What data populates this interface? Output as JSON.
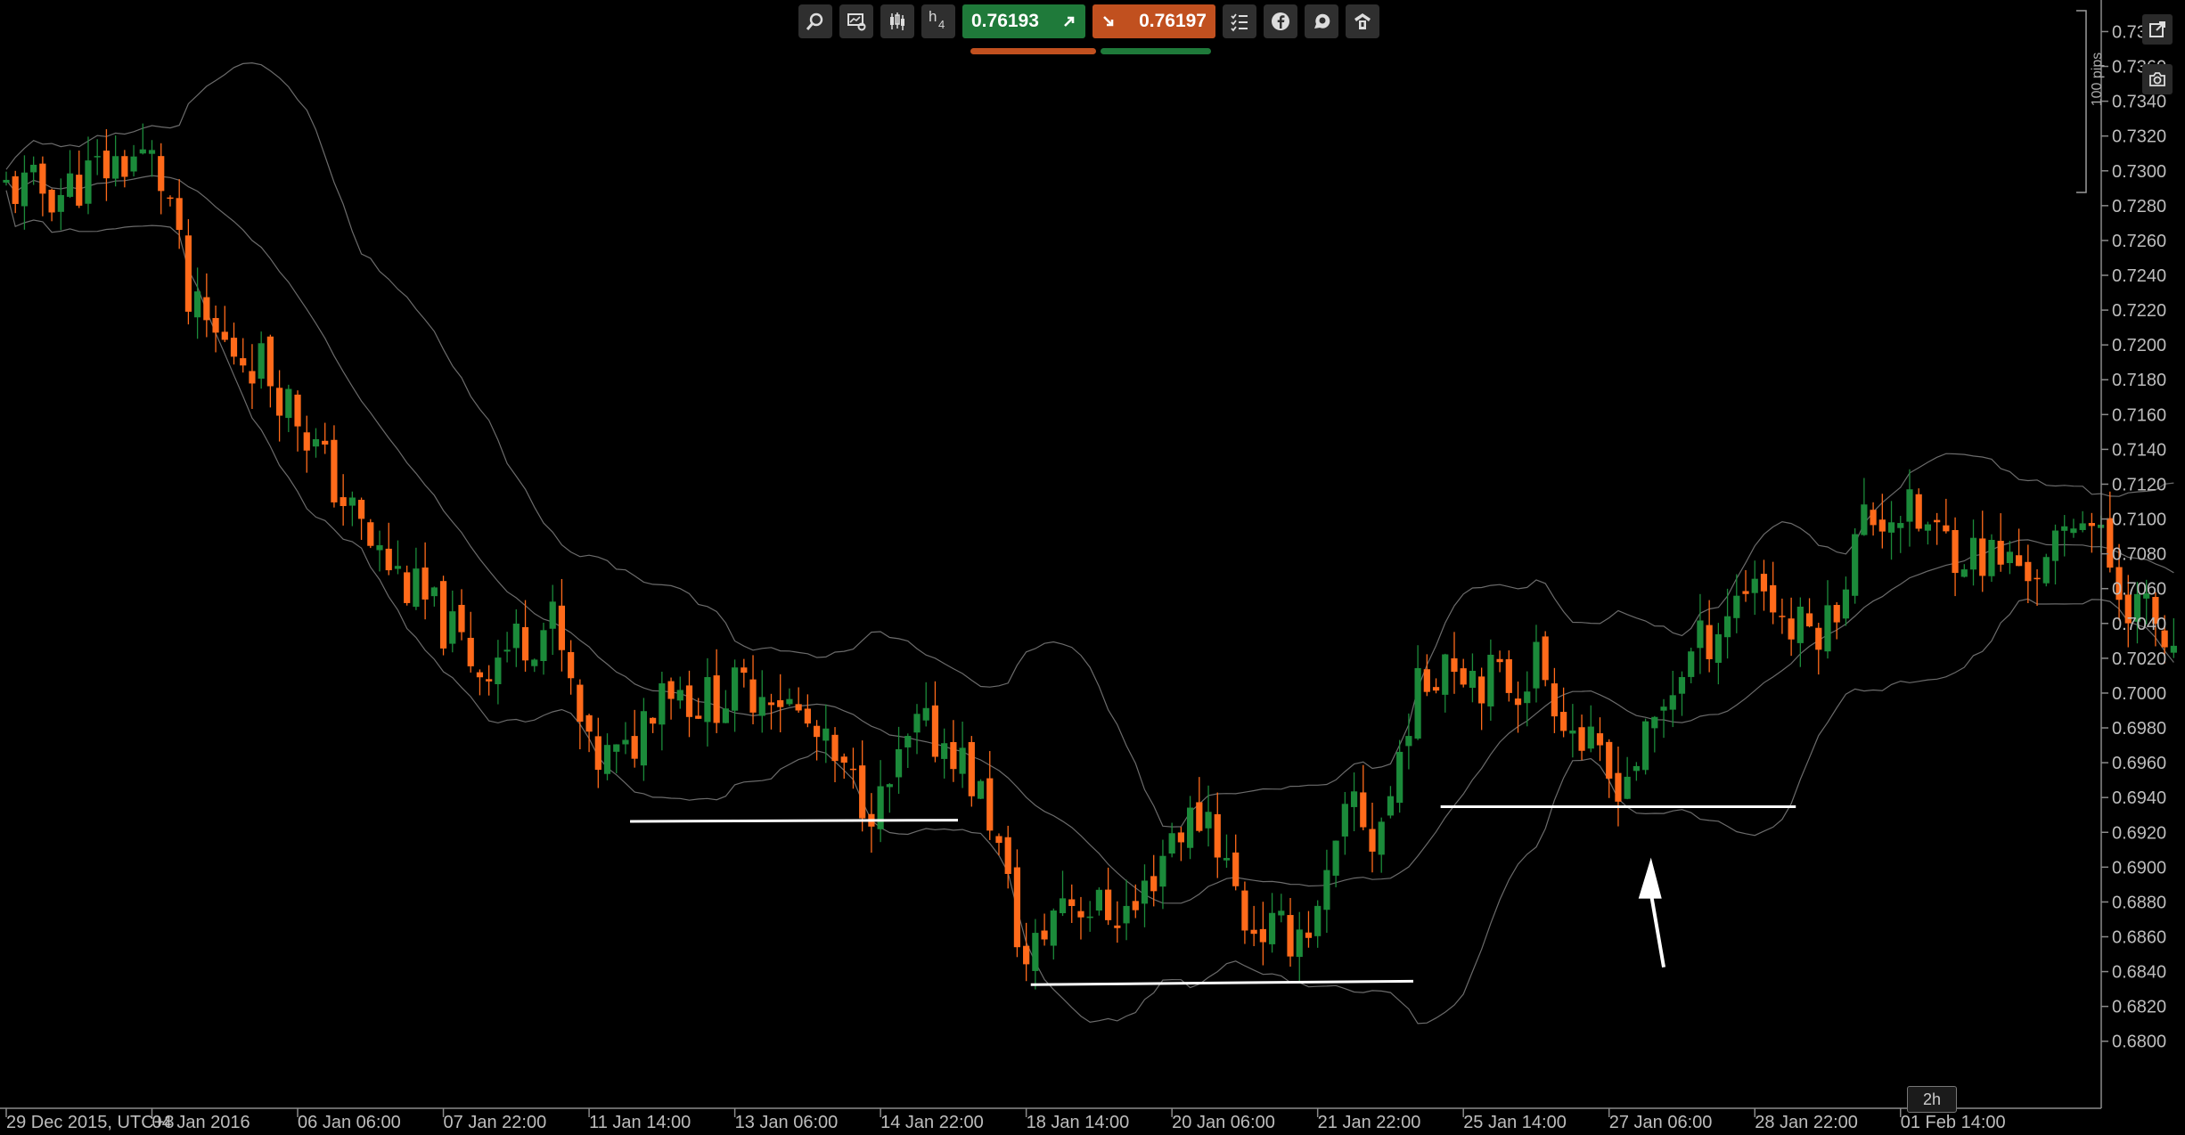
{
  "toolbar": {
    "icons": [
      "zoom-icon",
      "chart-settings-icon",
      "candlestick-icon",
      "timeframe-icon",
      "sell-price-button",
      "buy-price-button",
      "checklist-icon",
      "facebook-icon",
      "chat-icon",
      "profile-icon"
    ],
    "timeframe_letter": "h",
    "timeframe_number": "4",
    "sell_price": "0.76193",
    "buy_price": "0.76197",
    "sell_color": "#1f7a3a",
    "buy_color": "#c1501f"
  },
  "right_panel": {
    "pips_label": "100 pips",
    "icons": [
      "popout-icon",
      "camera-icon"
    ]
  },
  "zoom_label": "2h",
  "colors": {
    "bull": "#1b8a3a",
    "bear": "#ff6a1a",
    "band": "#6b6b6b",
    "axis": "#8a8a8a",
    "annotation": "#ffffff"
  },
  "chart_data": {
    "type": "candlestick",
    "y_ticks": [
      "0.7380",
      "0.7360",
      "0.7340",
      "0.7320",
      "0.7300",
      "0.7280",
      "0.7260",
      "0.7240",
      "0.7220",
      "0.7200",
      "0.7180",
      "0.7160",
      "0.7140",
      "0.7120",
      "0.7100",
      "0.7080",
      "0.7060",
      "0.7040",
      "0.7020",
      "0.7000",
      "0.6980",
      "0.6960",
      "0.6940",
      "0.6920",
      "0.6900",
      "0.6880",
      "0.6860",
      "0.6840",
      "0.6820",
      "0.6800"
    ],
    "ylim": [
      0.6784,
      0.7392
    ],
    "x_labels": [
      {
        "i": 0,
        "label": "29 Dec 2015, UTC+8"
      },
      {
        "i": 16,
        "label": "04 Jan 2016"
      },
      {
        "i": 32,
        "label": "06 Jan 06:00"
      },
      {
        "i": 48,
        "label": "07 Jan 22:00"
      },
      {
        "i": 64,
        "label": "11 Jan 14:00"
      },
      {
        "i": 80,
        "label": "13 Jan 06:00"
      },
      {
        "i": 96,
        "label": "14 Jan 22:00"
      },
      {
        "i": 112,
        "label": "18 Jan 14:00"
      },
      {
        "i": 128,
        "label": "20 Jan 06:00"
      },
      {
        "i": 144,
        "label": "21 Jan 22:00"
      },
      {
        "i": 160,
        "label": "25 Jan 14:00"
      },
      {
        "i": 176,
        "label": "27 Jan 06:00"
      },
      {
        "i": 192,
        "label": "28 Jan 22:00"
      },
      {
        "i": 208,
        "label": "01 Feb 14:00"
      }
    ],
    "anchors_close": [
      [
        0,
        0.729
      ],
      [
        6,
        0.7288
      ],
      [
        10,
        0.73
      ],
      [
        14,
        0.7308
      ],
      [
        16,
        0.7305
      ],
      [
        18,
        0.7282
      ],
      [
        20,
        0.722
      ],
      [
        24,
        0.72
      ],
      [
        28,
        0.719
      ],
      [
        32,
        0.716
      ],
      [
        36,
        0.712
      ],
      [
        40,
        0.7085
      ],
      [
        44,
        0.7062
      ],
      [
        48,
        0.704
      ],
      [
        52,
        0.7015
      ],
      [
        56,
        0.703
      ],
      [
        60,
        0.704
      ],
      [
        64,
        0.6962
      ],
      [
        68,
        0.6962
      ],
      [
        72,
        0.701
      ],
      [
        76,
        0.6995
      ],
      [
        80,
        0.7
      ],
      [
        84,
        0.7005
      ],
      [
        88,
        0.698
      ],
      [
        92,
        0.695
      ],
      [
        96,
        0.6935
      ],
      [
        100,
        0.6978
      ],
      [
        104,
        0.697
      ],
      [
        108,
        0.693
      ],
      [
        112,
        0.6842
      ],
      [
        116,
        0.6885
      ],
      [
        120,
        0.6875
      ],
      [
        124,
        0.6875
      ],
      [
        128,
        0.692
      ],
      [
        132,
        0.6932
      ],
      [
        136,
        0.687
      ],
      [
        140,
        0.686
      ],
      [
        144,
        0.687
      ],
      [
        148,
        0.694
      ],
      [
        150,
        0.6915
      ],
      [
        152,
        0.694
      ],
      [
        154,
        0.699
      ],
      [
        158,
        0.7025
      ],
      [
        162,
        0.701
      ],
      [
        166,
        0.7005
      ],
      [
        168,
        0.702
      ],
      [
        172,
        0.698
      ],
      [
        176,
        0.695
      ],
      [
        178,
        0.6955
      ],
      [
        180,
        0.697
      ],
      [
        184,
        0.7015
      ],
      [
        188,
        0.704
      ],
      [
        192,
        0.707
      ],
      [
        196,
        0.7035
      ],
      [
        200,
        0.704
      ],
      [
        204,
        0.71
      ],
      [
        208,
        0.7105
      ],
      [
        212,
        0.709
      ],
      [
        216,
        0.708
      ],
      [
        220,
        0.7075
      ],
      [
        224,
        0.707
      ],
      [
        228,
        0.711
      ],
      [
        232,
        0.706
      ],
      [
        236,
        0.704
      ],
      [
        238,
        0.7015
      ]
    ],
    "candle_count": 239,
    "annotations": {
      "support_lines": [
        {
          "i1": 68.5,
          "i2": 104.5,
          "price1": 0.69263,
          "price2": 0.6927
        },
        {
          "i1": 112.5,
          "i2": 154.5,
          "price1": 0.68325,
          "price2": 0.68345
        },
        {
          "i1": 157.5,
          "i2": 196.5,
          "price1": 0.69347,
          "price2": 0.69347
        }
      ],
      "arrow": {
        "from_i": 182.0,
        "from_price": 0.68425,
        "to_i": 180.6,
        "to_price": 0.69055
      }
    }
  }
}
